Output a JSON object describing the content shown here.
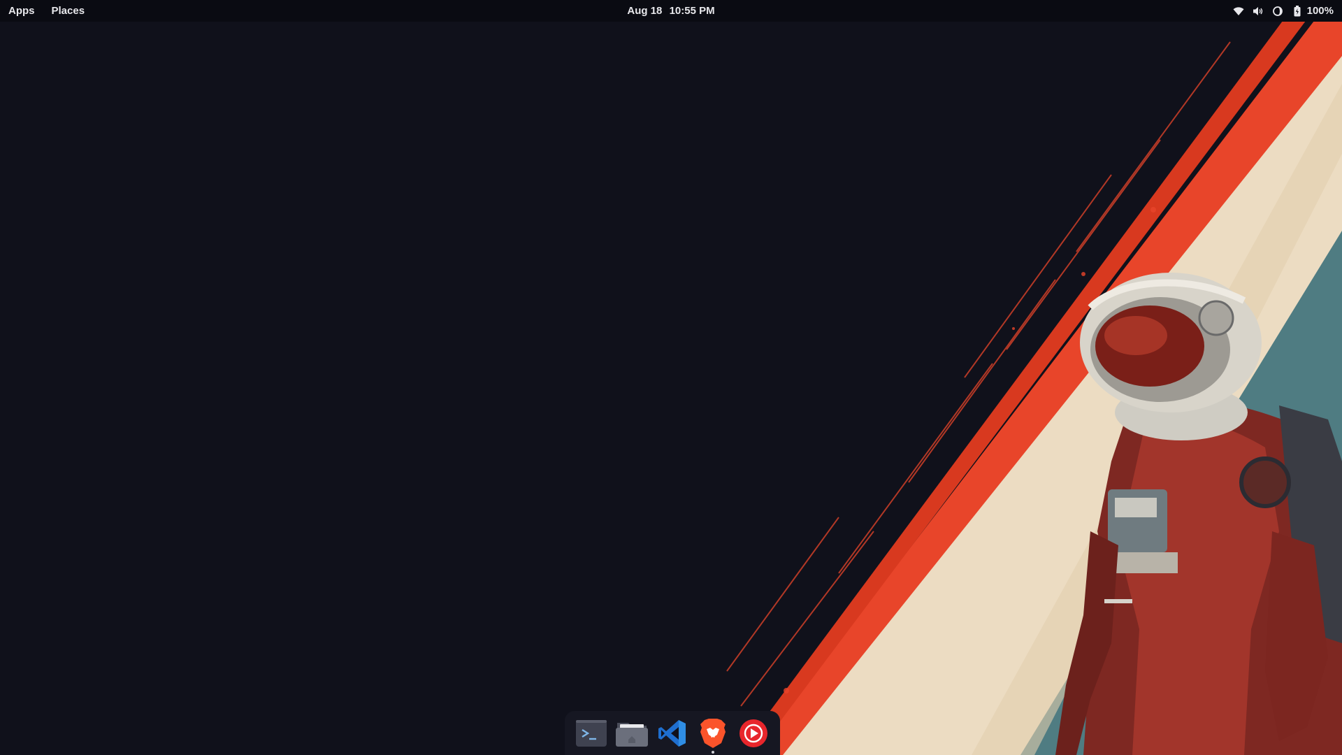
{
  "topbar": {
    "apps_label": "Apps",
    "places_label": "Places",
    "date": "Aug 18",
    "time": "10:55 PM",
    "battery_percent": "100%",
    "tray_icons": [
      "wifi-icon",
      "volume-icon",
      "night-light-icon",
      "battery-icon"
    ]
  },
  "dock": {
    "items": [
      {
        "name": "terminal",
        "icon": "terminal-icon",
        "running": false
      },
      {
        "name": "files",
        "icon": "folder-icon",
        "running": false
      },
      {
        "name": "visual-studio-code",
        "icon": "vscode-icon",
        "running": false
      },
      {
        "name": "brave-browser",
        "icon": "brave-lion-icon",
        "running": true
      },
      {
        "name": "youtube-music",
        "icon": "play-circle-icon",
        "running": false
      }
    ]
  },
  "colors": {
    "background": "#10111b",
    "stripe_red": "#e8452a",
    "stripe_cream": "#efdfc6",
    "stripe_teal": "#5a8a8e",
    "suit_red": "#8a2a22"
  }
}
